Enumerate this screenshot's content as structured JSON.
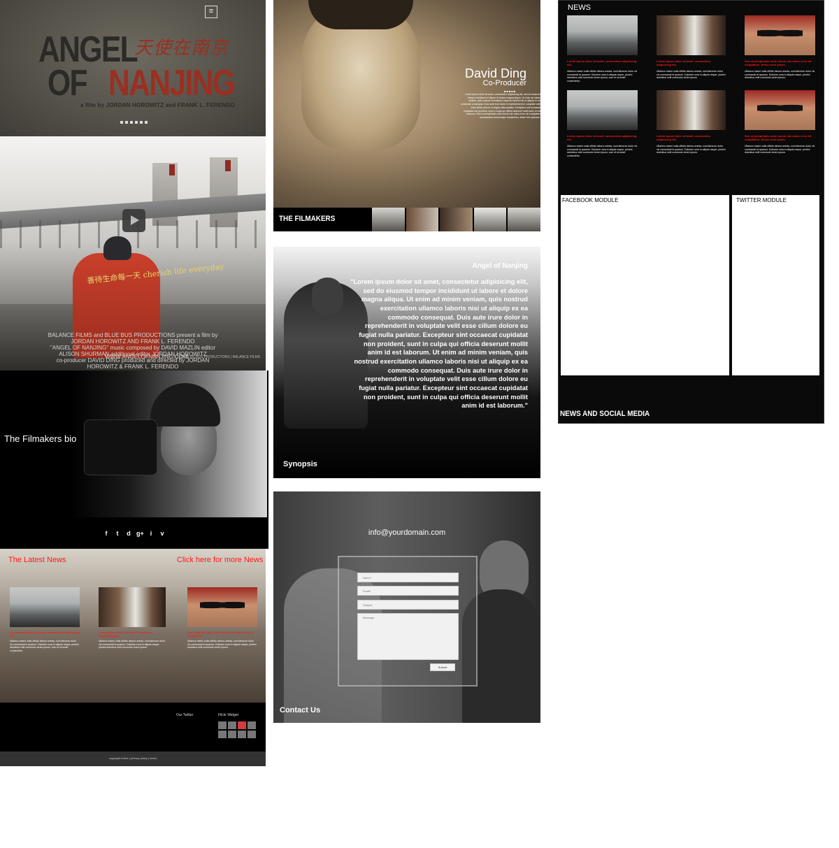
{
  "hero": {
    "menu_icon": "hamburger-menu-icon",
    "title_line1": "ANGEL",
    "title_line2a": "OF",
    "title_line2b": "NANJING",
    "title_chinese": "天使在南京",
    "credit": "a film by JORDAN HOROWITZ and FRANK L. FERENDO"
  },
  "poster": {
    "coat_text": "善待生命每一天 cherish life everyday",
    "credits_line1": "BALANCE FILMS and BLUE BUS PRODUCTIONS present a film by JORDAN HOROWITZ AND FRANK L. FERENDO",
    "credits_line2": "\"ANGEL OF NANJING\" music composed by DAVID MAZLIN editor ALISON SHURMAN additional editor JORDAN HOROWITZ",
    "credits_line3": "co-producer DAVID DING produced and directed by JORDAN HOROWITZ & FRANK L. FERENDO",
    "url": "WWW.ANGELOFNANJING.COM",
    "copyright": "© 2014 BLUE BUS PRODUCTIONS | BALANCE FILMS",
    "play_icon": "play-icon"
  },
  "bio": {
    "title": "The Filmakers bio",
    "social_icons": [
      "f",
      "t",
      "d",
      "g+",
      "i",
      "v"
    ]
  },
  "latest": {
    "title": "The Latest News",
    "more_link": "Click here for more News",
    "items": [
      {
        "headline": "Lorem ipsum dolor sit amet, consectetur adipisicing elit.",
        "body": "Ullamco maeci nulla officiis labora ummia, sunt laborum dolor vix commandi et quarum. Dolorem uma in aliquis neque, plurimi doloribus velit commodo lorem ipsum; cum et sit amet consectetur."
      },
      {
        "headline": "Lorem ipsum dolor sit amet, consectetur adipisicing elit.",
        "body": "Ullamco maeci nulla officiis labora ummia, sunt laborum dolor vix commandi et quarum. Dolorem uma in aliquis neque, plurimi doloribus velit commodo lorem ipsum."
      },
      {
        "headline": "Sed ut perspiciatis unde omnis iste natus error sit voluptatem.",
        "body": "Ullamco maeci nulla officiis labora ummia, sunt laborum dolor vix commandi et quarum. Dolorem uma in aliquis neque, plurimi doloribus velit commodo lorem ipsum."
      }
    ]
  },
  "footer": {
    "twitter_label": "Our Twitter",
    "flickr_label": "Flickr Widget",
    "copyright": "copyright notice | privacy policy | terms"
  },
  "david": {
    "name": "David Ding",
    "role": "Co-Producer",
    "bio": "Lorem ipsum dolor sit amet, consectetur adipisicing elit, sed do eiusmod tempor incididunt ut labore et dolore magna aliqua. Ut enim ad minim veniam, quis nostrud exercitation ullamco laboris nisi ut aliquip ex ea commodo consequat. Duis aute irure dolor in reprehenderit in voluptate velit esse cillum dolore eu fugiat nulla pariatur. Excepteur sint occaecat cupidatat non proident, sunt in culpa qui officia deserunt mollit anim id est laborum. Sed ut perspiciatis unde omnis iste natus error sit voluptatem accusantium doloremque laudantium, totam rem aperiam."
  },
  "filmakers": {
    "title": "THE FILMAKERS"
  },
  "synopsis": {
    "heading": "Angel of Nanjing",
    "quote": "\"Lorem ipsum dolor sit amet, consectetur adipisicing elit, sed do eiusmod tempor incididunt ut labore et dolore magna aliqua. Ut enim ad minim veniam, quis nostrud exercitation ullamco laboris nisi ut aliquip ex ea commodo consequat. Duis aute irure dolor in reprehenderit in voluptate velit esse cillum dolore eu fugiat nulla pariatur. Excepteur sint occaecat cupidatat non proident, sunt in culpa qui officia deserunt mollit anim id est laborum. Ut enim ad minim veniam, quis nostrud exercitation ullamco laboris nisi ut aliquip ex ea commodo consequat. Duis aute irure dolor in reprehenderit in voluptate velit esse cillum dolore eu fugiat nulla pariatur. Excepteur sint occaecat cupidatat non proident, sunt in culpa qui officia deserunt mollit anim id est laborum.\"",
    "label": "Synopsis"
  },
  "contact": {
    "email": "info@yourdomain.com",
    "name_placeholder": "Name*",
    "email_placeholder": "Email*",
    "subject_placeholder": "Subject",
    "message_placeholder": "Message",
    "submit": "Submit",
    "label": "Contact Us"
  },
  "news": {
    "title": "NEWS",
    "items": [
      {
        "headline": "Lorem ipsum dolor sit amet, consectetur adipisicing elit.",
        "body": "Ullamco maeci nulla officiis labora ummia, sunt laborum dolor vix commandi et quarum. Dolorem uma in aliquis neque, plurimi doloribus velit commodo lorem ipsum; cum et sit amet consectetur."
      },
      {
        "headline": "Lorem ipsum dolor sit amet, consectetur adipisicing elit.",
        "body": "Ullamco maeci nulla officiis labora ummia, sunt laborum dolor vix commandi et quarum. Dolorem uma in aliquis neque, plurimi doloribus velit commodo lorem ipsum."
      },
      {
        "headline": "Sed ut perspiciatis unde omnis iste natus error sit voluptatem. Nemo enim ipsam.",
        "body": "Ullamco maeci nulla officiis labora ummia, sunt laborum dolor vix commandi et quarum. Dolorem uma in aliquis neque, plurimi doloribus velit commodo lorem ipsum."
      },
      {
        "headline": "Lorem ipsum dolor sit amet, consectetur adipisicing elit.",
        "body": "Ullamco maeci nulla officiis labora ummia, sunt laborum dolor vix commandi et quarum. Dolorem uma in aliquis neque, plurimi doloribus velit commodo lorem ipsum; cum et sit amet consectetur."
      },
      {
        "headline": "Lorem ipsum dolor sit amet, consectetur adipisicing elit.",
        "body": "Ullamco maeci nulla officiis labora ummia, sunt laborum dolor vix commandi et quarum. Dolorem uma in aliquis neque, plurimi doloribus velit commodo lorem ipsum."
      },
      {
        "headline": "Sed ut perspiciatis unde omnis iste natus error sit voluptatem. Nemo enim ipsam.",
        "body": "Ullamco maeci nulla officiis labora ummia, sunt laborum dolor vix commandi et quarum. Dolorem uma in aliquis neque, plurimi doloribus velit commodo lorem ipsum."
      }
    ],
    "facebook_label": "FACEBOOK MODULE",
    "twitter_label": "TWITTER MODULE",
    "section_label": "NEWS AND SOCIAL MEDIA"
  }
}
